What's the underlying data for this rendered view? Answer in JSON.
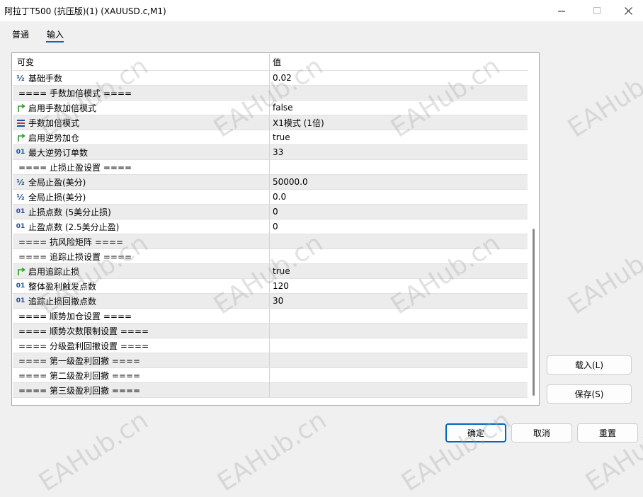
{
  "window": {
    "title": "阿拉丁T500  (抗压版)(1) (XAUUSD.c,M1)"
  },
  "tabs": [
    {
      "label": "普通"
    },
    {
      "label": "输入"
    }
  ],
  "table": {
    "headers": [
      "可变",
      "值"
    ],
    "rows": [
      {
        "icon": "half-icon",
        "name": "基础手数",
        "value": "0.02"
      },
      {
        "icon": "",
        "name": "==== 手数加倍模式 ====",
        "value": ""
      },
      {
        "icon": "toggle-arrow-icon",
        "name": "启用手数加倍模式",
        "value": "false"
      },
      {
        "icon": "enum-list-icon",
        "name": "手数加倍模式",
        "value": "X1模式 (1倍)"
      },
      {
        "icon": "toggle-arrow-icon",
        "name": "启用逆势加仓",
        "value": "true"
      },
      {
        "icon": "integer-icon",
        "name": "最大逆势订单数",
        "value": "33"
      },
      {
        "icon": "",
        "name": "==== 止损止盈设置 ====",
        "value": ""
      },
      {
        "icon": "half-icon",
        "name": "全局止盈(美分)",
        "value": "50000.0"
      },
      {
        "icon": "half-icon",
        "name": "全局止损(美分)",
        "value": "0.0"
      },
      {
        "icon": "integer-icon",
        "name": "止损点数 (5美分止损)",
        "value": "0"
      },
      {
        "icon": "integer-icon",
        "name": "止盈点数 (2.5美分止盈)",
        "value": "0"
      },
      {
        "icon": "",
        "name": "==== 抗风险矩阵 ====",
        "value": ""
      },
      {
        "icon": "",
        "name": "==== 追踪止损设置 ====",
        "value": ""
      },
      {
        "icon": "toggle-arrow-icon",
        "name": "启用追踪止损",
        "value": "true"
      },
      {
        "icon": "integer-icon",
        "name": "整体盈利触发点数",
        "value": "120"
      },
      {
        "icon": "integer-icon",
        "name": "追踪止损回撤点数",
        "value": "30"
      },
      {
        "icon": "",
        "name": "==== 顺势加仓设置 ====",
        "value": ""
      },
      {
        "icon": "",
        "name": "==== 顺势次数限制设置 ====",
        "value": ""
      },
      {
        "icon": "",
        "name": "==== 分级盈利回撤设置 ====",
        "value": ""
      },
      {
        "icon": "",
        "name": "==== 第一级盈利回撤 ====",
        "value": ""
      },
      {
        "icon": "",
        "name": "==== 第二级盈利回撤 ====",
        "value": ""
      },
      {
        "icon": "",
        "name": "==== 第三级盈利回撤 ====",
        "value": ""
      }
    ]
  },
  "side_buttons": {
    "load": "载入(L)",
    "save": "保存(S)"
  },
  "bottom_buttons": {
    "ok": "确定",
    "cancel": "取消",
    "reset": "重置"
  },
  "watermark": "EAHub.cn",
  "colors": {
    "accent": "#0067c0",
    "icon_blue": "#1a4fa0",
    "icon_green": "#2e9b2e",
    "icon_red": "#d0342c"
  }
}
